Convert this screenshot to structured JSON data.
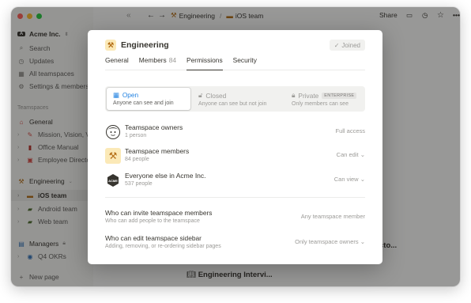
{
  "topbar": {
    "breadcrumb_1": "Engineering",
    "separator": "/",
    "breadcrumb_2": "iOS team",
    "share_label": "Share"
  },
  "sidebar": {
    "workspace": "Acme Inc.",
    "items": [
      {
        "label": "Search",
        "icon": "search-icon"
      },
      {
        "label": "Updates",
        "icon": "clock-icon"
      },
      {
        "label": "All teamspaces",
        "icon": "grid-icon"
      },
      {
        "label": "Settings & members",
        "icon": "gear-icon"
      }
    ],
    "teamspaces_heading": "Teamspaces",
    "general": "General",
    "general_pages": [
      "Mission, Vision, V",
      "Office Manual",
      "Employee Directo"
    ],
    "engineering": "Engineering",
    "engineering_pages": [
      "iOS team",
      "Android team",
      "Web team"
    ],
    "managers": "Managers",
    "manager_pages": [
      "Q4 OKRs"
    ],
    "new_page": "New page"
  },
  "background": {
    "doc_fragment": "cto...",
    "doc_title": "Engineering Intervi..."
  },
  "modal": {
    "title": "Engineering",
    "joined_label": "Joined",
    "tabs": [
      {
        "label": "General",
        "count": ""
      },
      {
        "label": "Members",
        "count": "84"
      },
      {
        "label": "Permissions",
        "count": ""
      },
      {
        "label": "Security",
        "count": ""
      }
    ],
    "active_tab": "Permissions",
    "visibility": [
      {
        "title": "Open",
        "desc": "Anyone can see and join",
        "badge": ""
      },
      {
        "title": "Closed",
        "desc": "Anyone can see but not join",
        "badge": ""
      },
      {
        "title": "Private",
        "desc": "Only members can see",
        "badge": "ENTERPRISE"
      }
    ],
    "selected_visibility": "Open",
    "permissions": [
      {
        "name": "Teamspace owners",
        "sub": "1 person",
        "level": "Full access",
        "icon": "avatar-icon"
      },
      {
        "name": "Teamspace members",
        "sub": "84 people",
        "level": "Can edit",
        "icon": "hammer-icon"
      },
      {
        "name": "Everyone else in Acme Inc.",
        "sub": "537 people",
        "level": "Can view",
        "icon": "acme-logo-icon"
      }
    ],
    "settings": [
      {
        "name": "Who can invite teamspace members",
        "sub": "Who can add people to the teamspace",
        "value": "Any teamspace member"
      },
      {
        "name": "Who can edit teamspace sidebar",
        "sub": "Adding, removing, or re-ordering sidebar pages",
        "value": "Only teamspace owners"
      }
    ]
  },
  "colors": {
    "accent": "#2383e2",
    "traffic_red": "#ff5f57",
    "traffic_yellow": "#febc2e",
    "traffic_green": "#28c840"
  }
}
